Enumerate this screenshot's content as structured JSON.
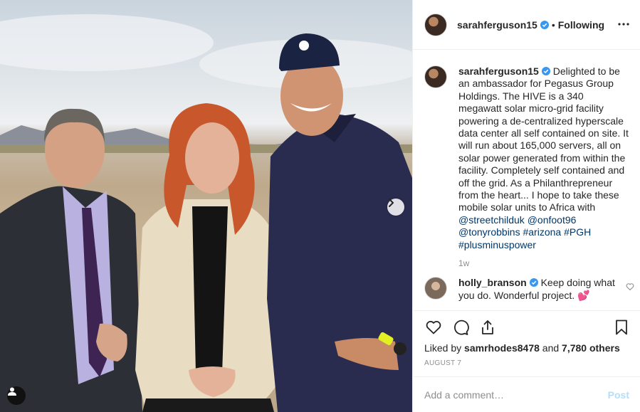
{
  "post": {
    "author": "sarahferguson15",
    "follow_status": "Following",
    "separator": "•",
    "caption": {
      "username": "sarahferguson15",
      "text": " Delighted to be an ambassador for Pegasus Group Holdings. The HIVE is a 340 megawatt solar micro-grid facility powering a de-centralized hyperscale data center all self contained on site. It will run about 165,000 servers, all on solar power generated from within the facility. Completely self contained and off the grid. As a Philanthrepreneur from the heart... I hope to take these mobile solar units to Africa with ",
      "tags": [
        "@streetchilduk",
        "@onfoot96",
        "@tonyrobbins",
        "#arizona",
        "#PGH",
        "#plusminuspower"
      ],
      "time_ago": "1w"
    },
    "comments": [
      {
        "username": "holly_branson",
        "text": " Keep doing what you do. Wonderful project. ",
        "emoji": "💕"
      }
    ],
    "likes": {
      "prefix": "Liked by ",
      "user": "samrhodes8478",
      "middle": " and ",
      "others": "7,780 others"
    },
    "date": "AUGUST 7",
    "add_comment_placeholder": "Add a comment…",
    "post_button": "Post"
  },
  "icons": [
    "verified-badge-icon",
    "more-options-icon",
    "heart-icon",
    "comment-icon",
    "share-icon",
    "bookmark-icon",
    "chevron-right-icon",
    "user-tag-icon"
  ],
  "colors": {
    "verified": "#3897f0",
    "link": "#00376b",
    "muted": "#8e8e8e",
    "post_disabled": "#b2dffc"
  }
}
